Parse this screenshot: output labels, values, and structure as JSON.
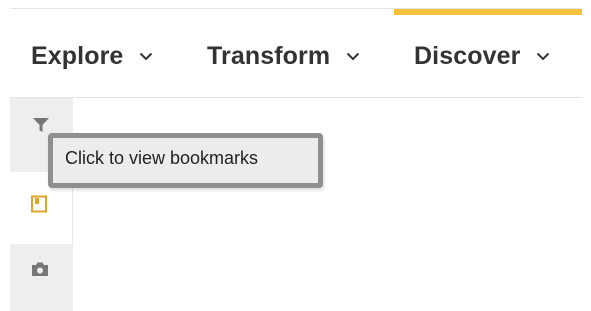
{
  "colors": {
    "accent": "#f5c33b",
    "nav_text": "#333333",
    "rail_background": "#eeeeee",
    "bookmark_active": "#e0a526",
    "icon_gray": "#777777",
    "tooltip_border": "#8f8f8f"
  },
  "nav": {
    "items": [
      {
        "label": "Explore",
        "icon": "chevron-down-icon"
      },
      {
        "label": "Transform",
        "icon": "chevron-down-icon"
      },
      {
        "label": "Discover",
        "icon": "chevron-down-icon"
      }
    ]
  },
  "side_rail": {
    "buttons": [
      {
        "icon": "filter-icon",
        "active": false
      },
      {
        "icon": "bookmark-icon",
        "active": true
      },
      {
        "icon": "camera-icon",
        "active": false
      }
    ]
  },
  "tooltip": {
    "text": "Click to view bookmarks"
  }
}
